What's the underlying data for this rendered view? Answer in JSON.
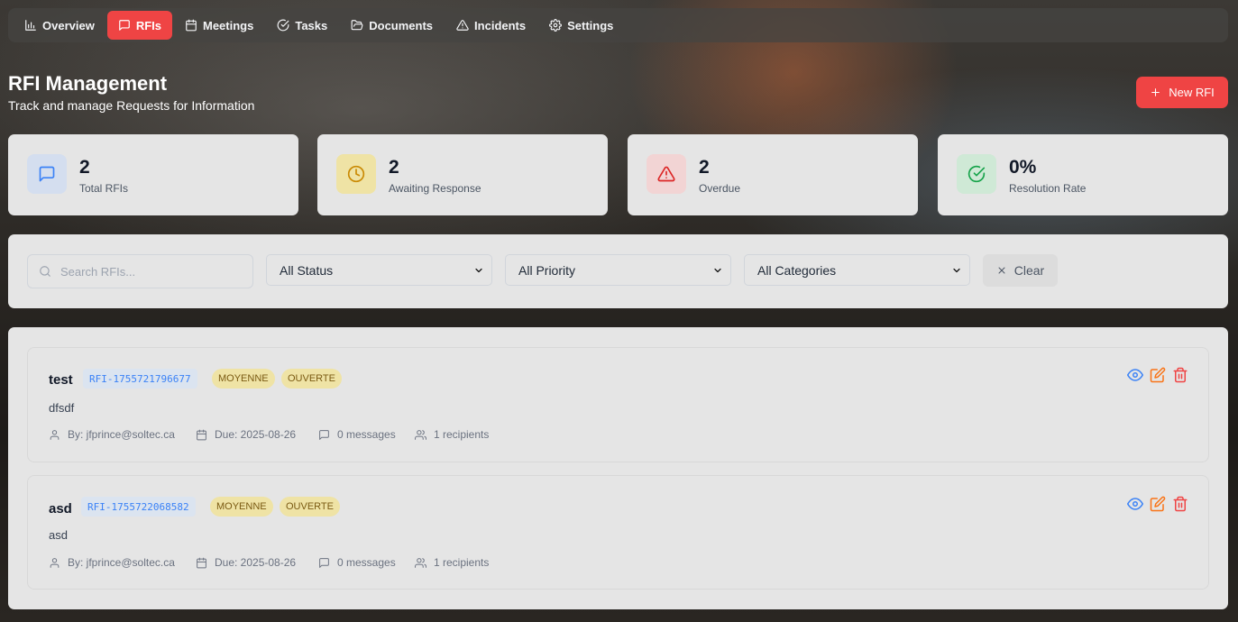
{
  "nav": {
    "items": [
      {
        "label": "Overview",
        "icon": "bar-chart-icon"
      },
      {
        "label": "RFIs",
        "icon": "message-square-icon",
        "active": true
      },
      {
        "label": "Meetings",
        "icon": "calendar-icon"
      },
      {
        "label": "Tasks",
        "icon": "check-circle-icon"
      },
      {
        "label": "Documents",
        "icon": "folder-open-icon"
      },
      {
        "label": "Incidents",
        "icon": "alert-triangle-icon"
      },
      {
        "label": "Settings",
        "icon": "gear-icon"
      }
    ],
    "active_color": "#ef4444"
  },
  "header": {
    "title": "RFI Management",
    "subtitle": "Track and manage Requests for Information",
    "new_button_label": "New RFI"
  },
  "stats": [
    {
      "value": "2",
      "label": "Total RFIs",
      "icon": "message-square-icon",
      "color": "#3b82f6"
    },
    {
      "value": "2",
      "label": "Awaiting Response",
      "icon": "clock-icon",
      "color": "#ca8a04"
    },
    {
      "value": "2",
      "label": "Overdue",
      "icon": "alert-triangle-icon",
      "color": "#dc2626"
    },
    {
      "value": "0%",
      "label": "Resolution Rate",
      "icon": "check-circle-icon",
      "color": "#16a34a"
    }
  ],
  "filters": {
    "search_placeholder": "Search RFIs...",
    "status": "All Status",
    "priority": "All Priority",
    "category": "All Categories",
    "clear_label": "Clear"
  },
  "rfis": [
    {
      "title": "test",
      "id": "RFI-1755721796677",
      "priority": "MOYENNE",
      "status": "OUVERTE",
      "description": "dfsdf",
      "by": "By: jfprince@soltec.ca",
      "due": "Due: 2025-08-26",
      "messages": "0 messages",
      "recipients": "1 recipients"
    },
    {
      "title": "asd",
      "id": "RFI-1755722068582",
      "priority": "MOYENNE",
      "status": "OUVERTE",
      "description": "asd",
      "by": "By: jfprince@soltec.ca",
      "due": "Due: 2025-08-26",
      "messages": "0 messages",
      "recipients": "1 recipients"
    }
  ]
}
